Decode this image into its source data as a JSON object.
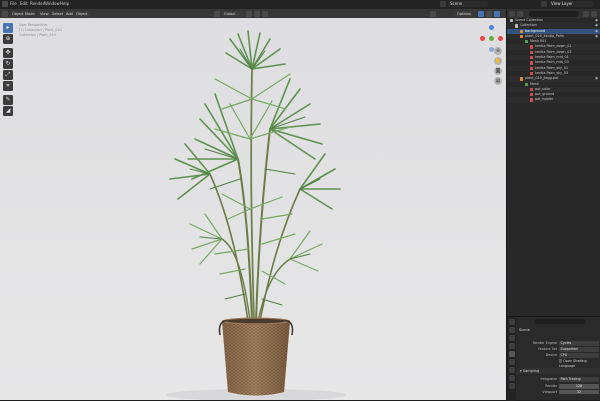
{
  "topbar": {
    "menu_items": [
      "File",
      "Edit",
      "Render",
      "Window",
      "Help"
    ],
    "scene_label": "Scene",
    "view_layer_label": "View Layer"
  },
  "viewport": {
    "mode": "Object Mode",
    "menus": [
      "View",
      "Select",
      "Add",
      "Object"
    ],
    "transform_orientation": "Global",
    "options_label": "Options",
    "overlay_lines": [
      "User Perspective",
      "(1) Collection | Plant_010",
      "Collection | Plant_010"
    ],
    "gizmo_colors": {
      "x": "#e8474b",
      "y": "#67b13f",
      "z": "#4b84d9"
    },
    "background_color": "#e2e2e4"
  },
  "outliner": {
    "title": "Scene Collection",
    "rows": [
      {
        "label": "Scene Collection",
        "indent": 0,
        "icon": "collection-icon",
        "color": "#bbbbbb"
      },
      {
        "label": "Collection",
        "indent": 1,
        "icon": "collection-icon",
        "color": "#bbbbbb"
      },
      {
        "label": "background",
        "indent": 2,
        "icon": "object-icon",
        "color": "#e08a3c",
        "selected": true
      },
      {
        "label": "plant_010_Kentia_Palm",
        "indent": 2,
        "icon": "object-icon",
        "color": "#e08a3c"
      },
      {
        "label": "Mesh.001",
        "indent": 3,
        "icon": "mesh-icon",
        "color": "#56a45a"
      },
      {
        "label": "kentia Palm_down_01",
        "indent": 4,
        "icon": "material-icon",
        "color": "#d44f4f"
      },
      {
        "label": "kentia Palm_down_03",
        "indent": 4,
        "icon": "material-icon",
        "color": "#d44f4f"
      },
      {
        "label": "kentia Palm_mid_01",
        "indent": 4,
        "icon": "material-icon",
        "color": "#d44f4f"
      },
      {
        "label": "kentia Palm_mid_03",
        "indent": 4,
        "icon": "material-icon",
        "color": "#d44f4f"
      },
      {
        "label": "kentia Palm_sky_01",
        "indent": 4,
        "icon": "material-icon",
        "color": "#d44f4f"
      },
      {
        "label": "kentia Palm_sky_03",
        "indent": 4,
        "icon": "material-icon",
        "color": "#d44f4f"
      },
      {
        "label": "plant_010_Jlegg.pot",
        "indent": 2,
        "icon": "object-icon",
        "color": "#e08a3c"
      },
      {
        "label": "Mesh",
        "indent": 3,
        "icon": "mesh-icon",
        "color": "#56a45a"
      },
      {
        "label": "pot_color",
        "indent": 4,
        "icon": "material-icon",
        "color": "#d44f4f"
      },
      {
        "label": "pot_ground",
        "indent": 4,
        "icon": "material-icon",
        "color": "#d44f4f"
      },
      {
        "label": "pot_holder",
        "indent": 4,
        "icon": "material-icon",
        "color": "#d44f4f"
      }
    ]
  },
  "properties": {
    "title": "Scene",
    "rows": [
      {
        "label": "Render Engine",
        "value": "Cycles"
      },
      {
        "label": "Feature Set",
        "value": "Supported"
      },
      {
        "label": "Device",
        "value": "CPU"
      }
    ],
    "checkbox_label": "Open Shading Language",
    "section_label": "Sampling",
    "integrator": {
      "label": "Integrator",
      "value": "Path Tracing"
    },
    "render": {
      "label": "Render",
      "value": "128"
    },
    "viewport": {
      "label": "Viewport",
      "value": "32"
    }
  }
}
